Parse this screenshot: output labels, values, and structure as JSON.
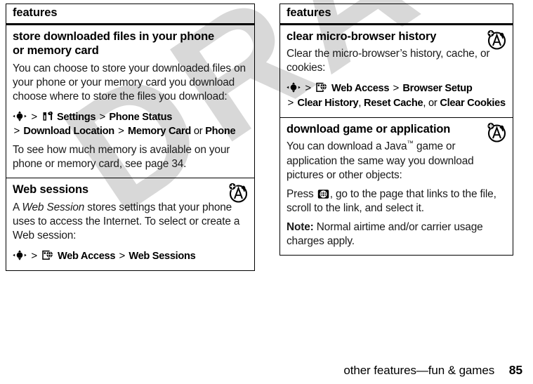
{
  "document": {
    "watermark_text": "DRAFT",
    "footer": {
      "title": "other features—fun & games",
      "page_number": "85"
    }
  },
  "left_table": {
    "header": "features",
    "rows": [
      {
        "title": "store downloaded files in your phone or memory card",
        "paragraph_1": "You can choose to store your downloaded files on your phone or your memory card you download choose where to store the files you download:",
        "path": {
          "center_icon": "center-key-icon",
          "menu_icon": "settings-tools-icon",
          "segments": [
            {
              "text": "Settings",
              "style": "bold"
            },
            {
              "text": ">",
              "style": "sep"
            },
            {
              "text": "Phone Status",
              "style": "bold"
            },
            {
              "text": ">",
              "style": "sep"
            },
            {
              "text": "Download Location",
              "style": "bold"
            },
            {
              "text": ">",
              "style": "sep"
            },
            {
              "text": "Memory Card",
              "style": "bold"
            },
            {
              "text": "or",
              "style": "plain"
            },
            {
              "text": "Phone",
              "style": "bold"
            }
          ]
        },
        "paragraph_2": "To see how much memory is available on your phone or memory card, see page 34."
      },
      {
        "title": "Web sessions",
        "has_network_icon": true,
        "network_icon_name": "network-antenna-icon",
        "paragraph_lead": "A ",
        "paragraph_italic": "Web Session",
        "paragraph_rest": " stores settings that your phone uses to access the Internet. To select or create a Web session:",
        "path": {
          "center_icon": "center-key-icon",
          "menu_icon": "web-access-icon",
          "segments": [
            {
              "text": "Web Access",
              "style": "bold"
            },
            {
              "text": ">",
              "style": "sep"
            },
            {
              "text": "Web Sessions",
              "style": "bold"
            }
          ]
        }
      }
    ]
  },
  "right_table": {
    "header": "features",
    "rows": [
      {
        "title": "clear micro-browser history",
        "has_network_icon": true,
        "network_icon_name": "network-antenna-icon",
        "paragraph_1": "Clear the micro-browser’s history, cache, or cookies:",
        "path": {
          "center_icon": "center-key-icon",
          "menu_icon": "web-access-icon",
          "segments": [
            {
              "text": "Web Access",
              "style": "bold"
            },
            {
              "text": ">",
              "style": "sep"
            },
            {
              "text": "Browser Setup",
              "style": "bold"
            },
            {
              "text": ">",
              "style": "sep"
            },
            {
              "text": "Clear History",
              "style": "bold"
            },
            {
              "text": ",",
              "style": "comma"
            },
            {
              "text": "Reset Cache",
              "style": "bold"
            },
            {
              "text": ",",
              "style": "comma"
            },
            {
              "text": "or",
              "style": "plain"
            },
            {
              "text": "Clear Cookies",
              "style": "bold"
            }
          ]
        }
      },
      {
        "title": "download game or application",
        "has_network_icon": true,
        "network_icon_name": "network-antenna-icon",
        "paragraph_1": "You can download a Java™ game or application the same way you download pictures or other objects:",
        "paragraph_2_pre": "Press ",
        "paragraph_2_icon": "browser-globe-key-icon",
        "paragraph_2_post": ", go to the page that links to the file, scroll to the link, and select it.",
        "note_label": "Note:",
        "note_text": " Normal airtime and/or carrier usage charges apply."
      }
    ]
  }
}
